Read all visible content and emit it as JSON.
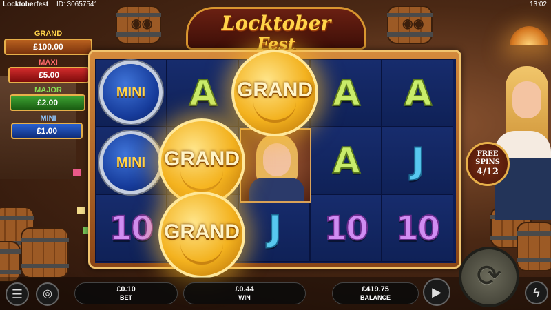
{
  "header": {
    "game_name": "Locktoberfest",
    "game_id": "ID: 30657541",
    "clock": "13:02"
  },
  "title": {
    "line1": "Locktober",
    "line2": "Fest"
  },
  "jackpots": [
    {
      "name": "GRAND",
      "value": "£100.00",
      "color": "#ffd34b"
    },
    {
      "name": "MAXI",
      "value": "£5.00",
      "color": "#d22c2c"
    },
    {
      "name": "MAJOR",
      "value": "£2.00",
      "color": "#3da333"
    },
    {
      "name": "MINI",
      "value": "£1.00",
      "color": "#2961d1"
    }
  ],
  "reels": {
    "columns": 5,
    "rows": 3,
    "grid": [
      [
        "MINI coin",
        "A",
        "GRAND coin",
        "A",
        "A"
      ],
      [
        "MINI coin",
        "GRAND coin",
        "character",
        "A",
        "J"
      ],
      [
        "10",
        "GRAND coin",
        "J",
        "10",
        "10"
      ]
    ],
    "coin_mini_text": "MINI",
    "coin_grand_text": "GRAND",
    "symbols": {
      "a": "A",
      "j": "J",
      "ten": "10"
    }
  },
  "free_spins": {
    "line1": "FREE",
    "line2": "SPINS",
    "count": "4/12"
  },
  "footer": {
    "bet_value": "£0.10",
    "bet_label": "BET",
    "win_value": "£0.44",
    "win_label": "WIN",
    "balance_value": "£419.75",
    "balance_label": "BALANCE"
  },
  "icons": {
    "menu": "menu-icon",
    "coins": "coin-stack-icon",
    "play": "play-icon",
    "spin": "spin-arrows-icon",
    "turbo": "lightning-icon"
  },
  "colors": {
    "reel_background": "#0d1c55",
    "frame": "#d48a3c",
    "gold": "#ffd34b"
  }
}
